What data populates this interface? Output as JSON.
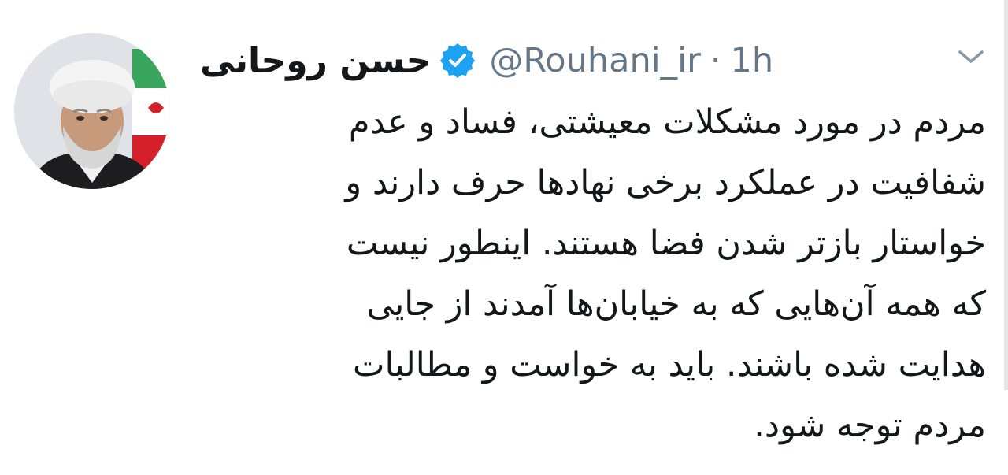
{
  "tweet": {
    "display_name": "حسن روحانی",
    "verified_icon": "verified-badge-icon",
    "handle": "@Rouhani_ir",
    "separator": "·",
    "time": "1h",
    "menu_icon": "chevron-down-icon",
    "text_lines": [
      "مردم در مورد مشکلات معیشتی، فساد و عدم",
      "شفافیت در عملکرد برخی نهادها حرف دارند و",
      "خواستار بازتر شدن فضا هستند. اینطور نیست",
      "که همه آن‌هایی که به خیابان‌ها آمدند از جایی",
      "هدایت شده باشند. باید به خواست و مطالبات",
      "مردم توجه شود."
    ]
  },
  "colors": {
    "text": "#14171a",
    "secondary": "#657786",
    "verified": "#1da1f2"
  }
}
